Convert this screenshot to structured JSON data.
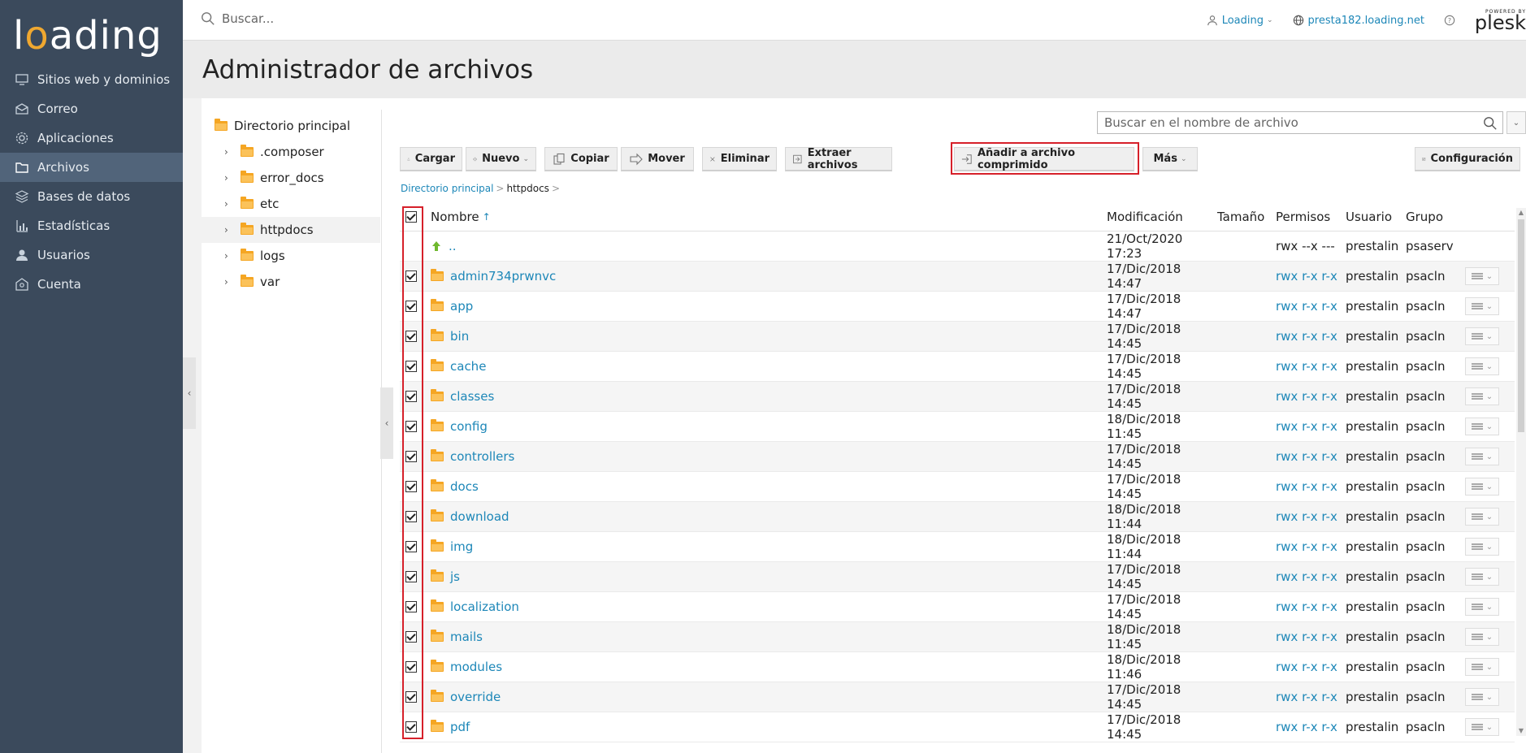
{
  "brand": {
    "logo_prefix": "l",
    "logo_o": "o",
    "logo_rest": "ading",
    "powered_by": "POWERED BY",
    "plesk": "plesk"
  },
  "sidebar": {
    "items": [
      {
        "label": "Sitios web y dominios",
        "icon": "monitor-icon"
      },
      {
        "label": "Correo",
        "icon": "mail-icon"
      },
      {
        "label": "Aplicaciones",
        "icon": "gear-icon"
      },
      {
        "label": "Archivos",
        "icon": "folder-icon",
        "active": true
      },
      {
        "label": "Bases de datos",
        "icon": "database-icon"
      },
      {
        "label": "Estadísticas",
        "icon": "chart-icon"
      },
      {
        "label": "Usuarios",
        "icon": "user-icon"
      },
      {
        "label": "Cuenta",
        "icon": "account-icon"
      }
    ]
  },
  "topbar": {
    "search_placeholder": "Buscar...",
    "user_label": "Loading",
    "domain_label": "presta182.loading.net"
  },
  "page_title": "Administrador de archivos",
  "tree": {
    "root": "Directorio principal",
    "items": [
      ".composer",
      "error_docs",
      "etc",
      "httpdocs",
      "logs",
      "var"
    ],
    "active": "httpdocs"
  },
  "file_search_placeholder": "Buscar en el nombre de archivo",
  "toolbar": {
    "upload": "Cargar",
    "new": "Nuevo",
    "copy": "Copiar",
    "move": "Mover",
    "delete": "Eliminar",
    "extract": "Extraer archivos",
    "add_archive": "Añadir a archivo comprimido",
    "more": "Más",
    "settings": "Configuración"
  },
  "breadcrumb": {
    "root": "Directorio principal",
    "current": "httpdocs"
  },
  "table": {
    "headers": {
      "name": "Nombre",
      "modified": "Modificación",
      "size": "Tamaño",
      "perms": "Permisos",
      "user": "Usuario",
      "group": "Grupo"
    },
    "parent_row": {
      "name": "..",
      "modified": "21/Oct/2020 17:23",
      "perms": "rwx --x ---",
      "user": "prestalin",
      "group": "psaserv"
    },
    "rows": [
      {
        "name": "admin734prwnvc",
        "modified": "17/Dic/2018 14:47",
        "perms": "rwx r-x r-x",
        "user": "prestalin",
        "group": "psacln"
      },
      {
        "name": "app",
        "modified": "17/Dic/2018 14:47",
        "perms": "rwx r-x r-x",
        "user": "prestalin",
        "group": "psacln"
      },
      {
        "name": "bin",
        "modified": "17/Dic/2018 14:45",
        "perms": "rwx r-x r-x",
        "user": "prestalin",
        "group": "psacln"
      },
      {
        "name": "cache",
        "modified": "17/Dic/2018 14:45",
        "perms": "rwx r-x r-x",
        "user": "prestalin",
        "group": "psacln"
      },
      {
        "name": "classes",
        "modified": "17/Dic/2018 14:45",
        "perms": "rwx r-x r-x",
        "user": "prestalin",
        "group": "psacln"
      },
      {
        "name": "config",
        "modified": "18/Dic/2018 11:45",
        "perms": "rwx r-x r-x",
        "user": "prestalin",
        "group": "psacln"
      },
      {
        "name": "controllers",
        "modified": "17/Dic/2018 14:45",
        "perms": "rwx r-x r-x",
        "user": "prestalin",
        "group": "psacln"
      },
      {
        "name": "docs",
        "modified": "17/Dic/2018 14:45",
        "perms": "rwx r-x r-x",
        "user": "prestalin",
        "group": "psacln"
      },
      {
        "name": "download",
        "modified": "18/Dic/2018 11:44",
        "perms": "rwx r-x r-x",
        "user": "prestalin",
        "group": "psacln"
      },
      {
        "name": "img",
        "modified": "18/Dic/2018 11:44",
        "perms": "rwx r-x r-x",
        "user": "prestalin",
        "group": "psacln"
      },
      {
        "name": "js",
        "modified": "17/Dic/2018 14:45",
        "perms": "rwx r-x r-x",
        "user": "prestalin",
        "group": "psacln"
      },
      {
        "name": "localization",
        "modified": "17/Dic/2018 14:45",
        "perms": "rwx r-x r-x",
        "user": "prestalin",
        "group": "psacln"
      },
      {
        "name": "mails",
        "modified": "18/Dic/2018 11:45",
        "perms": "rwx r-x r-x",
        "user": "prestalin",
        "group": "psacln"
      },
      {
        "name": "modules",
        "modified": "18/Dic/2018 11:46",
        "perms": "rwx r-x r-x",
        "user": "prestalin",
        "group": "psacln"
      },
      {
        "name": "override",
        "modified": "17/Dic/2018 14:45",
        "perms": "rwx r-x r-x",
        "user": "prestalin",
        "group": "psacln"
      },
      {
        "name": "pdf",
        "modified": "17/Dic/2018 14:45",
        "perms": "rwx r-x r-x",
        "user": "prestalin",
        "group": "psacln"
      }
    ]
  },
  "colors": {
    "sidebar": "#3b4a5c",
    "accent": "#1d87b8",
    "highlight": "#d6202a",
    "folder": "#f5a623"
  }
}
